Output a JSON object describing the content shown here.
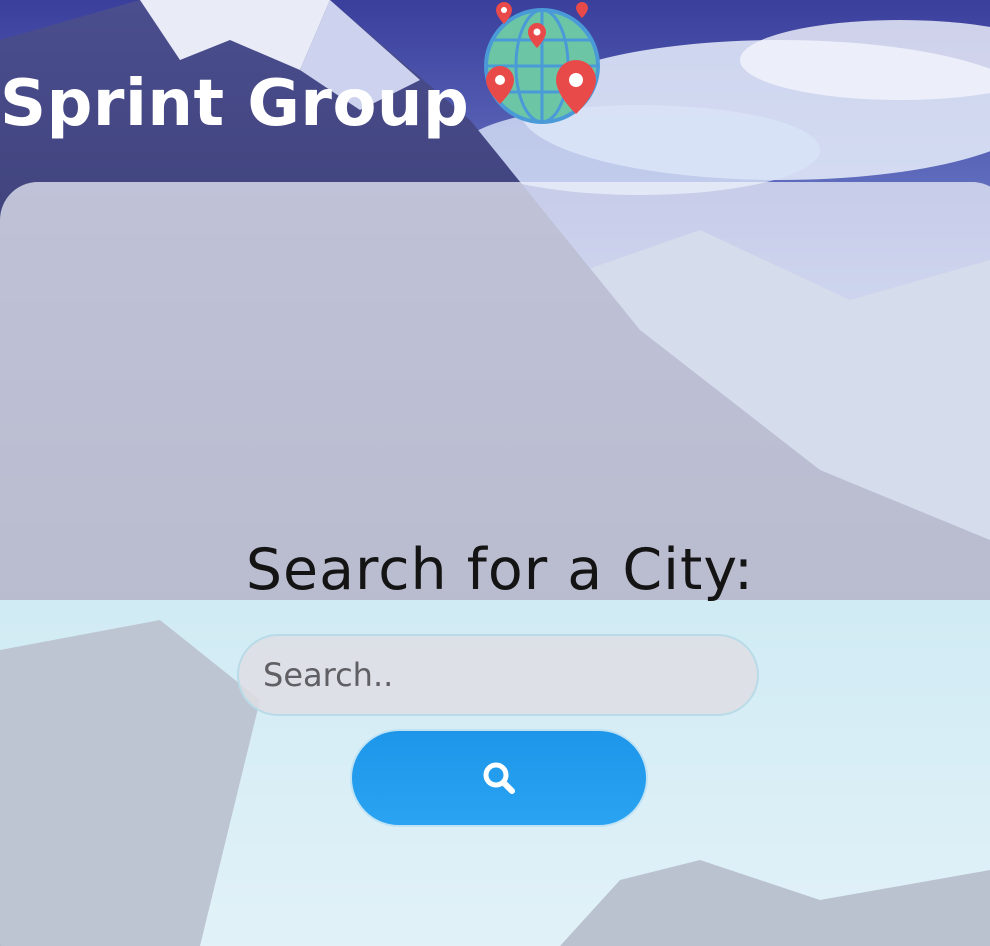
{
  "header": {
    "brand_title": "Sprint Group",
    "logo_icon": "globe-with-map-pins-icon"
  },
  "search": {
    "heading": "Search for a City:",
    "placeholder": "Search..",
    "value": "",
    "button_icon": "search-icon"
  },
  "colors": {
    "button_blue": "#2196F3",
    "panel_overlay": "rgba(240,242,250,0.72)",
    "title_text": "#141414",
    "brand_text": "#FFFFFF"
  }
}
